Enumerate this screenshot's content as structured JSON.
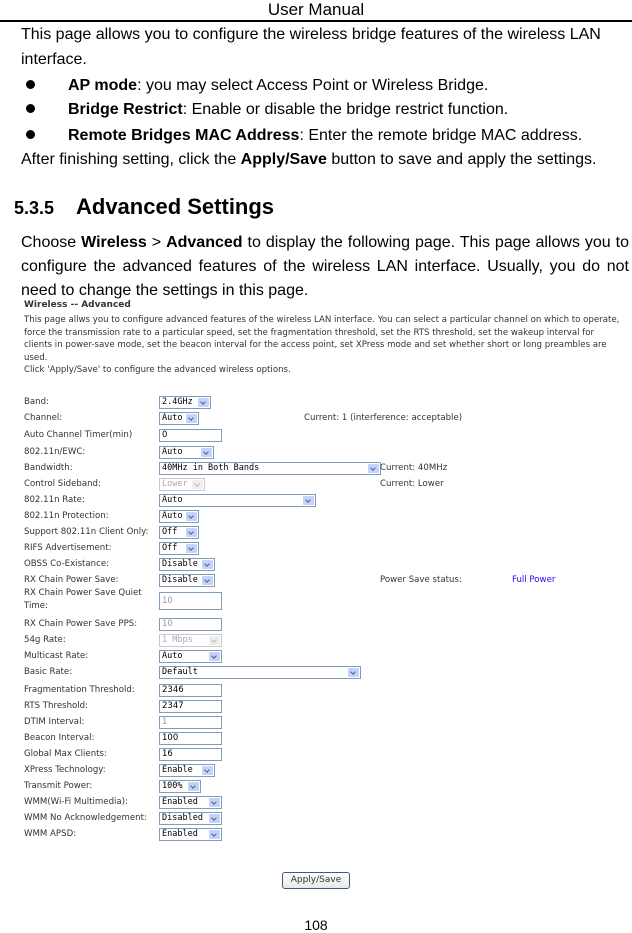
{
  "header": {
    "title": "User Manual"
  },
  "intro": {
    "line1": "This page allows you to configure the wireless bridge features of the wireless LAN",
    "line2": "interface.",
    "bullets": [
      {
        "term": "AP mode",
        "text": ": you may select Access Point or Wireless Bridge."
      },
      {
        "term": "Bridge Restrict",
        "text": ": Enable or disable the bridge restrict function."
      },
      {
        "term": "Remote Bridges MAC Address",
        "text": ": Enter the remote bridge MAC address."
      }
    ],
    "after_pre": "After finishing setting, click the ",
    "after_bold": "Apply/Save",
    "after_post": " button to save and apply the settings."
  },
  "section": {
    "number": "5.3.5",
    "title": "Advanced Settings",
    "p_choose": "Choose ",
    "p_wireless": "Wireless",
    "p_gt": " > ",
    "p_advanced": "Advanced",
    "p_rest": " to display the following page. This page allows you to configure the advanced features of the wireless LAN interface. Usually, you do not need to change the settings in this page."
  },
  "screen": {
    "title": "Wireless -- Advanced",
    "desc_lines": [
      "This page allws you to configure advanced features of the wireless LAN interface. You can select a particular channel on which to operate,",
      "force the transmission rate to a particular speed, set the fragmentation threshold, set the RTS threshold, set the wakeup interval for",
      "clients in power-save mode, set the beacon interval for the access point, set XPress mode and set whether short or long preambles are",
      "used.",
      "Click 'Apply/Save' to configure the advanced wireless options."
    ],
    "fields": [
      {
        "label": "Band:",
        "value": "2.4GHz",
        "type": "select"
      },
      {
        "label": "Channel:",
        "value": "Auto",
        "type": "select",
        "note": "Current: 1 (interference: acceptable)"
      },
      {
        "label": "Auto Channel Timer(min)",
        "value": "0",
        "type": "text"
      },
      {
        "label": "802.11n/EWC:",
        "value": "Auto",
        "type": "select"
      },
      {
        "label": "Bandwidth:",
        "value": "40MHz in Both Bands",
        "type": "select",
        "note": "Current: 40MHz"
      },
      {
        "label": "Control Sideband:",
        "value": "Lower",
        "type": "select",
        "disabled": true,
        "note": "Current: Lower"
      },
      {
        "label": "802.11n Rate:",
        "value": "Auto",
        "type": "select"
      },
      {
        "label": "802.11n Protection:",
        "value": "Auto",
        "type": "select"
      },
      {
        "label": "Support 802.11n Client Only:",
        "value": "Off",
        "type": "select"
      },
      {
        "label": "RIFS Advertisement:",
        "value": "Off",
        "type": "select"
      },
      {
        "label": "OBSS Co-Existance:",
        "value": "Disable",
        "type": "select"
      },
      {
        "label": "RX Chain Power Save:",
        "value": "Disable",
        "type": "select",
        "note_label": "Power Save status:",
        "note_value": "Full Power"
      },
      {
        "label": "RX Chain Power Save Quiet",
        "label2": "Time:",
        "value": "10",
        "type": "text",
        "disabled": true
      },
      {
        "label": "RX Chain Power Save PPS:",
        "value": "10",
        "type": "text",
        "disabled": true
      },
      {
        "label": "54g Rate:",
        "value": "1 Mbps",
        "type": "select",
        "disabled": true
      },
      {
        "label": "Multicast Rate:",
        "value": "Auto",
        "type": "select"
      },
      {
        "label": "Basic Rate:",
        "value": "Default",
        "type": "select"
      },
      {
        "label": "Fragmentation Threshold:",
        "value": "2346",
        "type": "text"
      },
      {
        "label": "RTS Threshold:",
        "value": "2347",
        "type": "text"
      },
      {
        "label": "DTIM Interval:",
        "value": "1",
        "type": "text",
        "disabled": true
      },
      {
        "label": "Beacon Interval:",
        "value": "100",
        "type": "text"
      },
      {
        "label": "Global Max Clients:",
        "value": "16",
        "type": "text"
      },
      {
        "label": "XPress Technology:",
        "value": "Enable",
        "type": "select"
      },
      {
        "label": "Transmit Power:",
        "value": "100%",
        "type": "select"
      },
      {
        "label": "WMM(Wi-Fi Multimedia):",
        "value": "Enabled",
        "type": "select"
      },
      {
        "label": "WMM No Acknowledgement:",
        "value": "Disabled",
        "type": "select"
      },
      {
        "label": "WMM APSD:",
        "value": "Enabled",
        "type": "select"
      }
    ],
    "apply_label": "Apply/Save",
    "colors": {
      "full_power": "#3300ff",
      "select_border": "#7f9db9",
      "arrow_bg": "#c3d3fd"
    }
  },
  "footer": {
    "page_number": "108"
  }
}
